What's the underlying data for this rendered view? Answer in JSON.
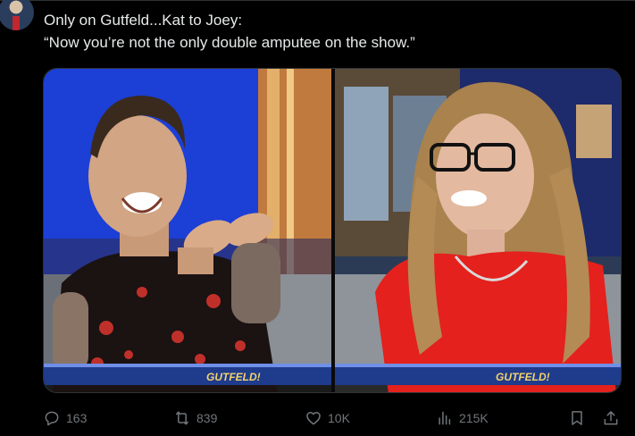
{
  "tweet": {
    "text_line1": "Only on Gutfeld...Kat to Joey:",
    "text_line2": "“Now you’re not the only double amputee on the show.”"
  },
  "media": {
    "banner_left": "GUTFELD!",
    "banner_right": "GUTFELD!"
  },
  "actions": {
    "replies": "163",
    "reposts": "839",
    "likes": "10K",
    "views": "215K"
  },
  "icons": [
    "avatar",
    "reply-icon",
    "repost-icon",
    "like-icon",
    "views-icon",
    "bookmark-icon",
    "share-icon"
  ],
  "colors": {
    "background": "#000000",
    "text": "#e7e9ea",
    "muted": "#71767b",
    "banner": "#1f3b8c"
  }
}
